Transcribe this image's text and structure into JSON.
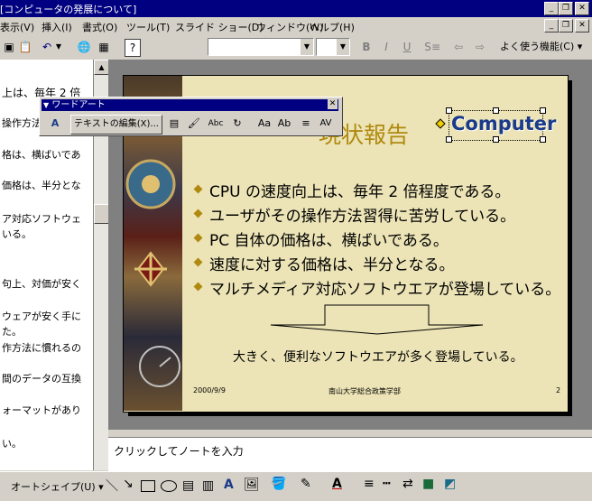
{
  "window": {
    "title": "[コンピュータの発展について]"
  },
  "menu": {
    "items": [
      "表示(V)",
      "挿入(I)",
      "書式(O)",
      "ツール(T)",
      "スライド ショー(D)",
      "ウィンドウ(W)",
      "ヘルプ(H)"
    ]
  },
  "toolbar": {
    "favorites_label": "よく使う機能(C)"
  },
  "outline": {
    "lines": [
      "上は、毎年 2 倍",
      "操作方法",
      "格は、横ばいであ",
      "価格は、半分とな",
      "ア対応ソフトウェ",
      "いる。",
      "句上、対価が安く",
      "ウェアが安く手に",
      "た。",
      "作方法に慣れるの",
      "間のデータの互換",
      "ォーマットがあり",
      "い。"
    ]
  },
  "wordart_toolbar": {
    "title": "ワードアート",
    "edit_text_label": "テキストの編集(X)..."
  },
  "slide": {
    "title": "現状報告",
    "wordart_text": "Computer",
    "bullets": [
      "CPU の速度向上は、毎年 2 倍程度である。",
      "ユーザがその操作方法習得に苦労している。",
      "PC 自体の価格は、横ばいである。",
      "速度に対する価格は、半分となる。",
      "マルチメディア対応ソフトウエアが登場している。"
    ],
    "conclusion": "大きく、便利なソフトウエアが多く登場している。",
    "footer_date": "2000/9/9",
    "footer_org": "南山大学総合政策学部",
    "footer_page": "2"
  },
  "notes": {
    "placeholder": "クリックしてノートを入力"
  },
  "drawing_toolbar": {
    "autoshape_label": "オートシェイプ(U)"
  },
  "colors": {
    "title_bar": "#000080",
    "slide_bg": "#ece4b6",
    "accent": "#b08a10"
  }
}
